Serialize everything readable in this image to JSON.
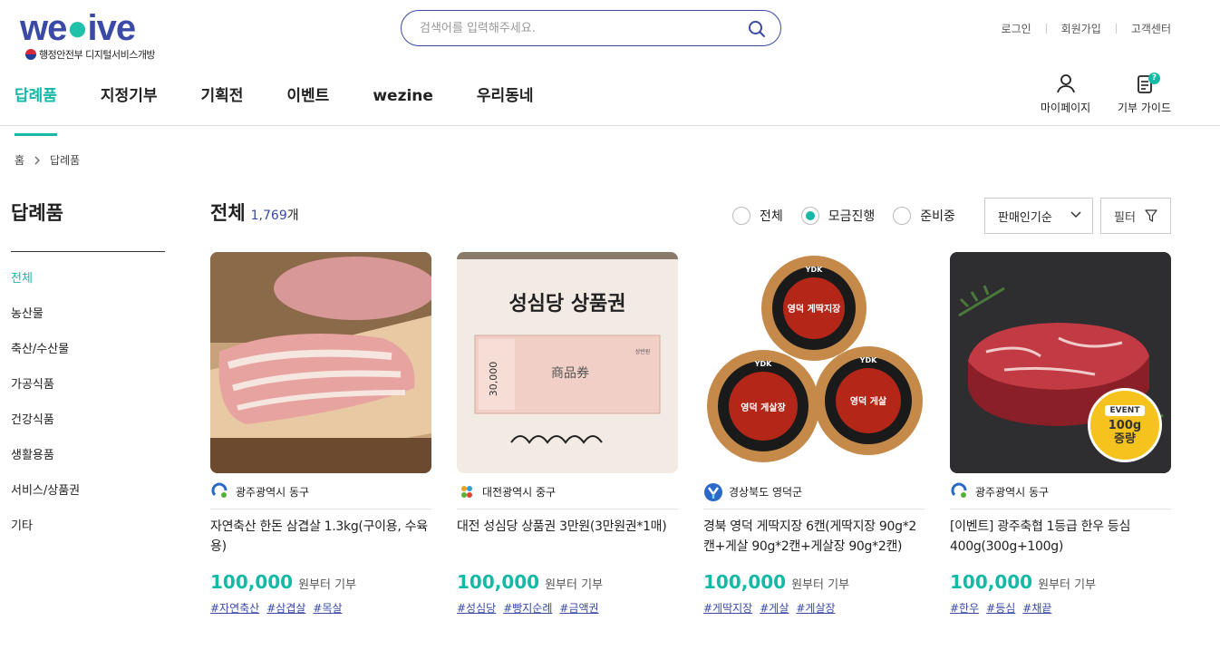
{
  "header": {
    "logo_text_a": "we",
    "logo_text_b": "ive",
    "logo_sub": "행정안전부 디지털서비스개방",
    "search_placeholder": "검색어를 입력해주세요.",
    "util": [
      "로그인",
      "회원가입",
      "고객센터"
    ],
    "nav": [
      "답례품",
      "지정기부",
      "기획전",
      "이벤트",
      "wezine",
      "우리동네"
    ],
    "mypage_label": "마이페이지",
    "guide_label": "기부 가이드",
    "guide_badge": "?"
  },
  "breadcrumb": {
    "home": "홈",
    "current": "답례품"
  },
  "sidebar": {
    "title": "답례품",
    "items": [
      "전체",
      "농산물",
      "축산/수산물",
      "가공식품",
      "건강식품",
      "생활용품",
      "서비스/상품권",
      "기타"
    ],
    "active_index": 0
  },
  "main": {
    "title": "전체",
    "count": "1,769",
    "count_unit": "개",
    "radios": [
      "전체",
      "모금진행",
      "준비중"
    ],
    "checked_radio": 1,
    "sort_label": "판매인기순",
    "filter_label": "필터"
  },
  "products": [
    {
      "org": "광주광역시 동구",
      "title": "자연축산 한돈 삼겹살 1.3kg(구이용, 수육용)",
      "price": "100,000",
      "price_label": "원부터 기부",
      "tags": [
        "#자연축산",
        "#삼겹살",
        "#목살"
      ]
    },
    {
      "org": "대전광역시 중구",
      "title": "대전 성심당 상품권 3만원(3만원권*1매)",
      "price": "100,000",
      "price_label": "원부터 기부",
      "tags": [
        "#성심당",
        "#빵지순례",
        "#금액권"
      ],
      "image_text": {
        "headline": "성심당 상품권",
        "voucher_amount": "30,000",
        "voucher_kanji": "商品券",
        "corner": "상반원"
      }
    },
    {
      "org": "경상북도 영덕군",
      "title": "경북 영덕 게딱지장 6캔(게딱지장 90g*2캔+게살 90g*2캔+게살장 90g*2캔)",
      "price": "100,000",
      "price_label": "원부터 기부",
      "tags": [
        "#게딱지장",
        "#게살",
        "#게살장"
      ],
      "image_text": {
        "can_brand": "YDK",
        "can_labels": [
          "영덕 게딱지장",
          "영덕 게살장",
          "영덕 게살"
        ]
      }
    },
    {
      "org": "광주광역시 동구",
      "title": "[이벤트] 광주축협 1등급 한우 등심 400g(300g+100g)",
      "price": "100,000",
      "price_label": "원부터 기부",
      "tags": [
        "#한우",
        "#등심",
        "#채끝"
      ],
      "event": {
        "tag": "EVENT",
        "line1": "100g",
        "line2": "증량"
      }
    }
  ],
  "colors": {
    "accent": "#16b8a6",
    "brand": "#3a4aa6"
  }
}
